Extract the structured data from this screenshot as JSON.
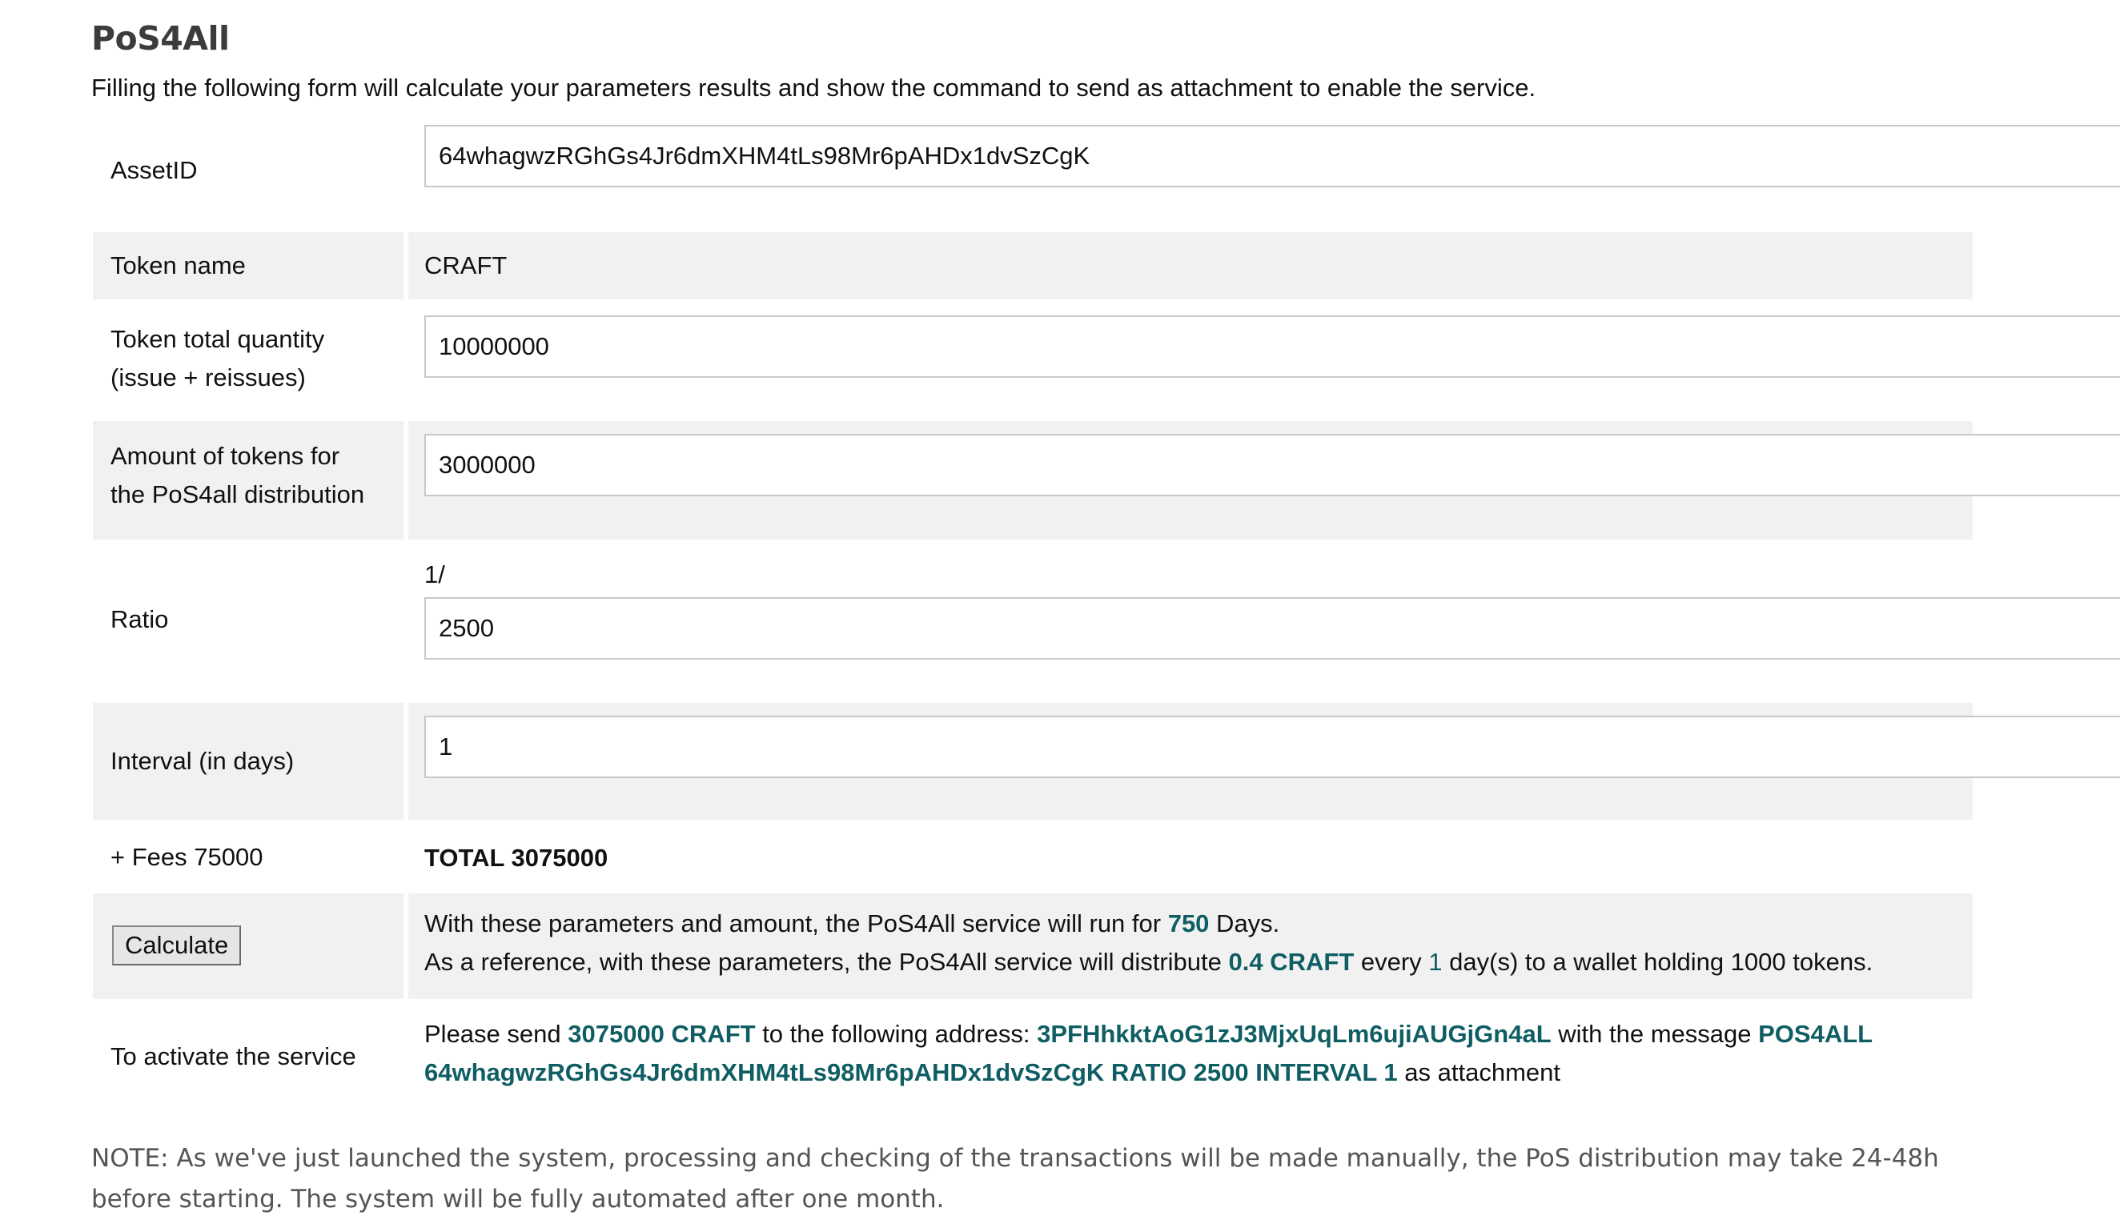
{
  "header": {
    "title": "PoS4All",
    "intro": "Filling the following form will calculate your parameters results and show the command to send as attachment to enable the service."
  },
  "form": {
    "asset_id": {
      "label": "AssetID",
      "value": "64whagwzRGhGs4Jr6dmXHM4tLs98Mr6pAHDx1dvSzCgK"
    },
    "token_name": {
      "label": "Token name",
      "value": "CRAFT"
    },
    "total_quantity": {
      "label_line1": "Token total quantity",
      "label_line2": "(issue + reissues)",
      "value": "10000000"
    },
    "distribution_amount": {
      "label_line1": "Amount of tokens for",
      "label_line2": "the PoS4all distribution",
      "value": "3000000"
    },
    "ratio": {
      "label": "Ratio",
      "prefix": "1/",
      "value": "2500"
    },
    "interval": {
      "label": "Interval (in days)",
      "value": "1"
    },
    "fees": {
      "label": "+ Fees 75000",
      "total": "TOTAL 3075000"
    }
  },
  "calculate": {
    "button_label": "Calculate",
    "line1_a": "With these parameters and amount, the PoS4All service will run for ",
    "line1_days": "750",
    "line1_b": " Days.",
    "line2_a": "As a reference, with these parameters, the PoS4All service will distribute ",
    "line2_amount": "0.4 CRAFT",
    "line2_b": " every ",
    "line2_interval": "1",
    "line2_c": " day(s) to a wallet holding 1000 tokens."
  },
  "activate": {
    "label": "To activate the service",
    "line1_a": "Please send ",
    "line1_amount": "3075000 CRAFT",
    "line1_b": " to the following address: ",
    "line1_address": "3PFHhkktAoG1zJ3MjxUqLm6ujiAUGjGn4aL",
    "line1_c": " with the message ",
    "line1_msg": "POS4ALL",
    "line2_msg": "64whagwzRGhGs4Jr6dmXHM4tLs98Mr6pAHDx1dvSzCgK RATIO 2500 INTERVAL 1",
    "line2_b": " as attachment"
  },
  "note": "NOTE: As we've just launched the system, processing and checking of the transactions will be made manually, the PoS distribution may take 24-48h before starting. The system will be fully automated after one month."
}
